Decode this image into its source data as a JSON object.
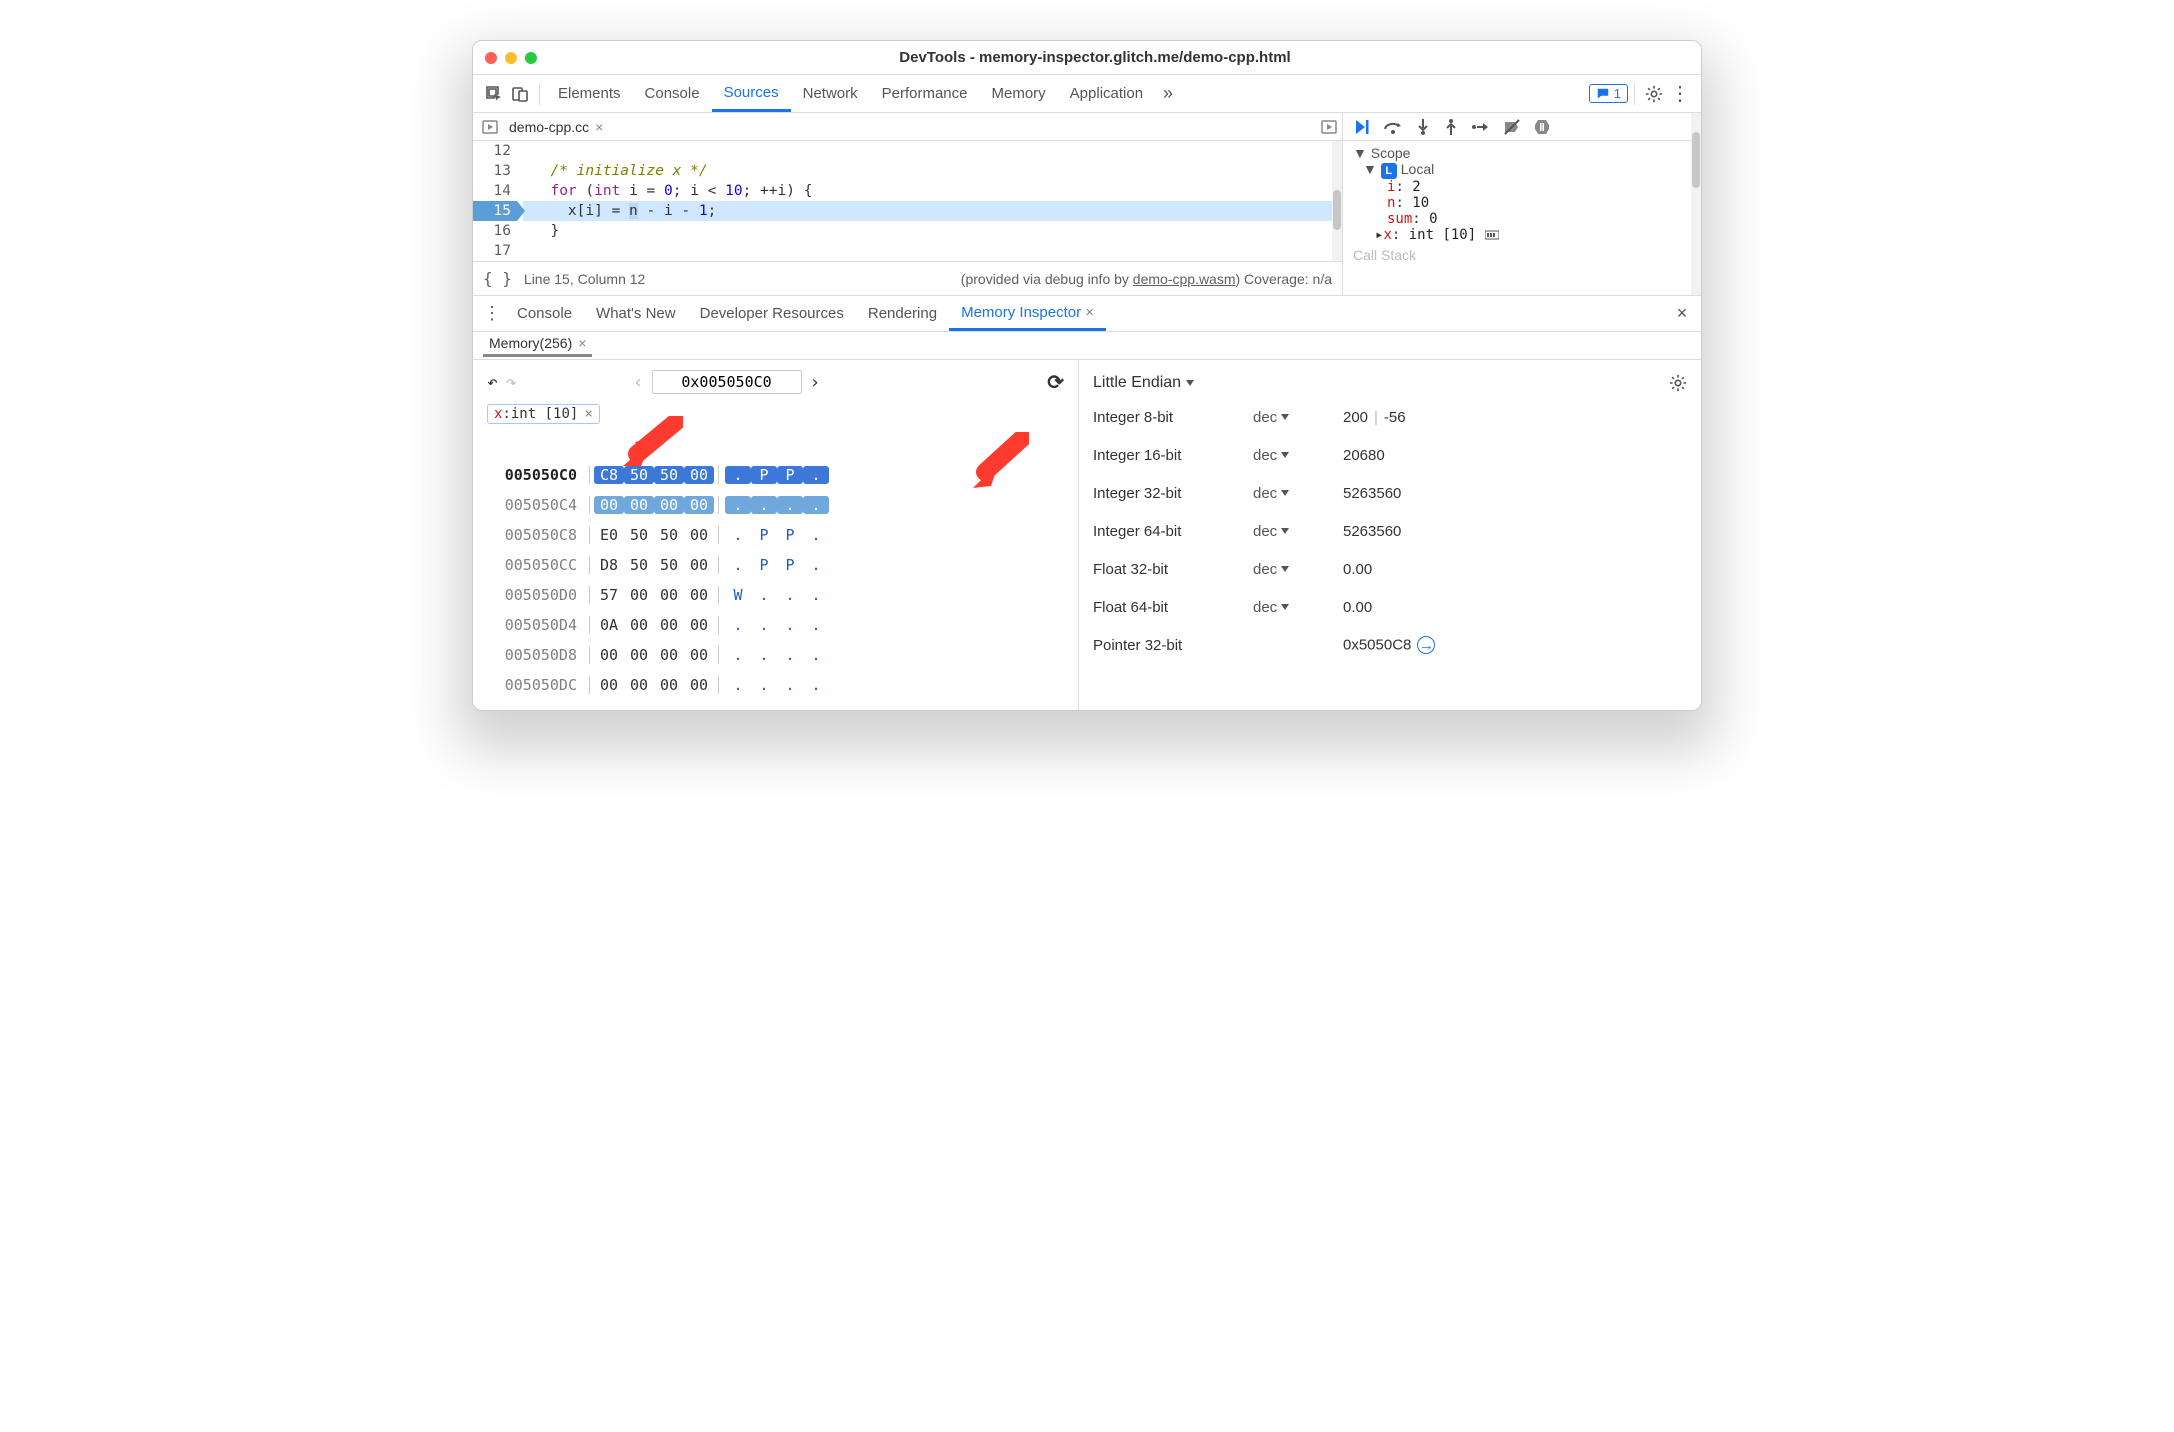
{
  "window": {
    "title": "DevTools - memory-inspector.glitch.me/demo-cpp.html"
  },
  "tabs": [
    "Elements",
    "Console",
    "Sources",
    "Network",
    "Performance",
    "Memory",
    "Application"
  ],
  "active_tab": "Sources",
  "messages_badge": "1",
  "source_file": {
    "name": "demo-cpp.cc"
  },
  "code": {
    "lines": [
      {
        "n": "12",
        "text": ""
      },
      {
        "n": "13",
        "text": "  /* initialize x */"
      },
      {
        "n": "14",
        "text": "  for (int i = 0; i < 10; ++i) {"
      },
      {
        "n": "15",
        "text": "    x[i] = n - i - 1;"
      },
      {
        "n": "16",
        "text": "  }"
      },
      {
        "n": "17",
        "text": ""
      }
    ],
    "highlight": "15"
  },
  "status": {
    "pos": "Line 15, Column 12",
    "info_pre": "(provided via debug info by ",
    "info_link": "demo-cpp.wasm",
    "info_post": ") Coverage: n/a"
  },
  "scope": {
    "header": "Scope",
    "local_label": "Local",
    "vars": [
      {
        "name": "i",
        "val": "2"
      },
      {
        "name": "n",
        "val": "10"
      },
      {
        "name": "sum",
        "val": "0"
      }
    ],
    "array": {
      "name": "x",
      "type": "int [10]"
    },
    "callstack": "Call Stack"
  },
  "drawer": {
    "tabs": [
      "Console",
      "What's New",
      "Developer Resources",
      "Rendering",
      "Memory Inspector"
    ],
    "active": "Memory Inspector",
    "memory_tab": "Memory(256)"
  },
  "memory": {
    "address": "0x005050C0",
    "chip": {
      "name": "x",
      "type": "int [10]"
    },
    "rows": [
      {
        "addr": "005050C0",
        "bytes": [
          "C8",
          "50",
          "50",
          "00"
        ],
        "ascii": [
          ".",
          "P",
          "P",
          "."
        ],
        "sel": 0
      },
      {
        "addr": "005050C4",
        "bytes": [
          "00",
          "00",
          "00",
          "00"
        ],
        "ascii": [
          ".",
          ".",
          ".",
          "."
        ],
        "sel": 1
      },
      {
        "addr": "005050C8",
        "bytes": [
          "E0",
          "50",
          "50",
          "00"
        ],
        "ascii": [
          ".",
          "P",
          "P",
          "."
        ]
      },
      {
        "addr": "005050CC",
        "bytes": [
          "D8",
          "50",
          "50",
          "00"
        ],
        "ascii": [
          ".",
          "P",
          "P",
          "."
        ]
      },
      {
        "addr": "005050D0",
        "bytes": [
          "57",
          "00",
          "00",
          "00"
        ],
        "ascii": [
          "W",
          ".",
          ".",
          "."
        ]
      },
      {
        "addr": "005050D4",
        "bytes": [
          "0A",
          "00",
          "00",
          "00"
        ],
        "ascii": [
          ".",
          ".",
          ".",
          "."
        ]
      },
      {
        "addr": "005050D8",
        "bytes": [
          "00",
          "00",
          "00",
          "00"
        ],
        "ascii": [
          ".",
          ".",
          ".",
          "."
        ]
      },
      {
        "addr": "005050DC",
        "bytes": [
          "00",
          "00",
          "00",
          "00"
        ],
        "ascii": [
          ".",
          ".",
          ".",
          "."
        ]
      }
    ]
  },
  "inspector": {
    "endian": "Little Endian",
    "rows": [
      {
        "label": "Integer 8-bit",
        "mode": "dec",
        "val_a": "200",
        "val_b": "-56"
      },
      {
        "label": "Integer 16-bit",
        "mode": "dec",
        "val": "20680"
      },
      {
        "label": "Integer 32-bit",
        "mode": "dec",
        "val": "5263560"
      },
      {
        "label": "Integer 64-bit",
        "mode": "dec",
        "val": "5263560"
      },
      {
        "label": "Float 32-bit",
        "mode": "dec",
        "val": "0.00"
      },
      {
        "label": "Float 64-bit",
        "mode": "dec",
        "val": "0.00"
      },
      {
        "label": "Pointer 32-bit",
        "mode": "",
        "val": "0x5050C8"
      }
    ]
  }
}
